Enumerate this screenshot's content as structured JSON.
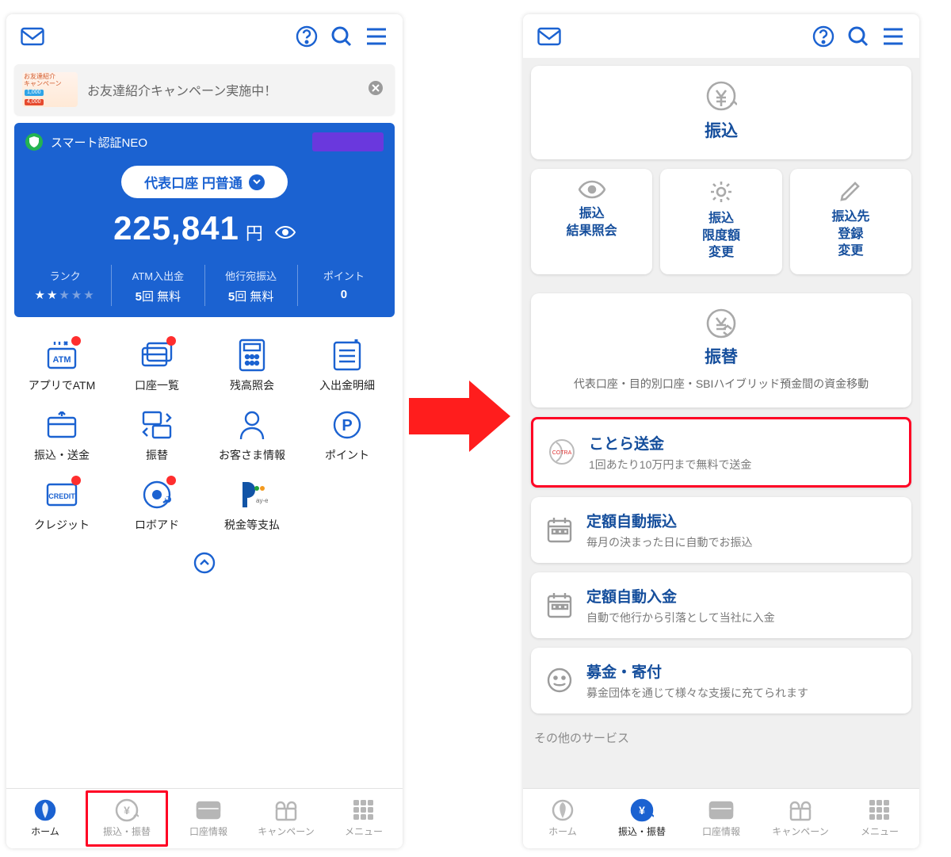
{
  "colors": {
    "accent": "#1b62d1",
    "highlight": "#ff0024",
    "cardBlue": "#1b62d1"
  },
  "left": {
    "banner": {
      "thumb_top": "お友達紹介",
      "thumb_mid": "キャンペーン",
      "thumb_badge1": "1,000",
      "thumb_badge2": "4,000",
      "text": "お友達紹介キャンペーン実施中！"
    },
    "card": {
      "badge": "スマート認証NEO",
      "account": "代表口座 円普通",
      "balance": "225,841",
      "balance_unit": "円",
      "stats": [
        {
          "label": "ランク",
          "value_stars": "★★",
          "value_stars_empty": "★★★"
        },
        {
          "label": "ATM入出金",
          "value_num": "5",
          "value_unit": "回  無料"
        },
        {
          "label": "他行宛振込",
          "value_num": "5",
          "value_unit": "回  無料"
        },
        {
          "label": "ポイント",
          "value_num": "0",
          "value_unit": ""
        }
      ]
    },
    "grid": [
      {
        "label": "アプリでATM",
        "icon": "atm",
        "dot": true
      },
      {
        "label": "口座一覧",
        "icon": "cards",
        "dot": true
      },
      {
        "label": "残高照会",
        "icon": "calc",
        "dot": false
      },
      {
        "label": "入出金明細",
        "icon": "list",
        "dot": false
      },
      {
        "label": "振込・送金",
        "icon": "cardup",
        "dot": false
      },
      {
        "label": "振替",
        "icon": "swap",
        "dot": false
      },
      {
        "label": "お客さま情報",
        "icon": "person",
        "dot": false
      },
      {
        "label": "ポイント",
        "icon": "pcircle",
        "dot": false
      },
      {
        "label": "クレジット",
        "icon": "credit",
        "dot": true
      },
      {
        "label": "ロボアド",
        "icon": "robo",
        "dot": true
      },
      {
        "label": "税金等支払",
        "icon": "payeasy",
        "dot": false
      }
    ],
    "bottomnav": [
      {
        "label": "ホーム",
        "active": true
      },
      {
        "label": "振込・振替",
        "highlight": true
      },
      {
        "label": "口座情報"
      },
      {
        "label": "キャンペーン"
      },
      {
        "label": "メニュー"
      }
    ]
  },
  "right": {
    "top": {
      "label": "振込"
    },
    "row3": [
      {
        "label": "振込\n結果照会",
        "icon": "eye"
      },
      {
        "label": "振込\n限度額\n変更",
        "icon": "gear"
      },
      {
        "label": "振込先\n登録\n変更",
        "icon": "pencil"
      }
    ],
    "tall": {
      "label": "振替",
      "sub": "代表口座・目的別口座・SBIハイブリッド預金間の資金移動"
    },
    "items": [
      {
        "title": "ことら送金",
        "desc": "1回あたり10万円まで無料で送金",
        "icon": "cotra",
        "highlight": true
      },
      {
        "title": "定額自動振込",
        "desc": "毎月の決まった日に自動でお振込",
        "icon": "cal"
      },
      {
        "title": "定額自動入金",
        "desc": "自動で他行から引落として当社に入金",
        "icon": "cal"
      },
      {
        "title": "募金・寄付",
        "desc": "募金団体を通じて様々な支援に充てられます",
        "icon": "smile"
      }
    ],
    "more": "その他のサービス",
    "bottomnav": [
      {
        "label": "ホーム"
      },
      {
        "label": "振込・振替",
        "active": true
      },
      {
        "label": "口座情報"
      },
      {
        "label": "キャンペーン"
      },
      {
        "label": "メニュー"
      }
    ]
  }
}
